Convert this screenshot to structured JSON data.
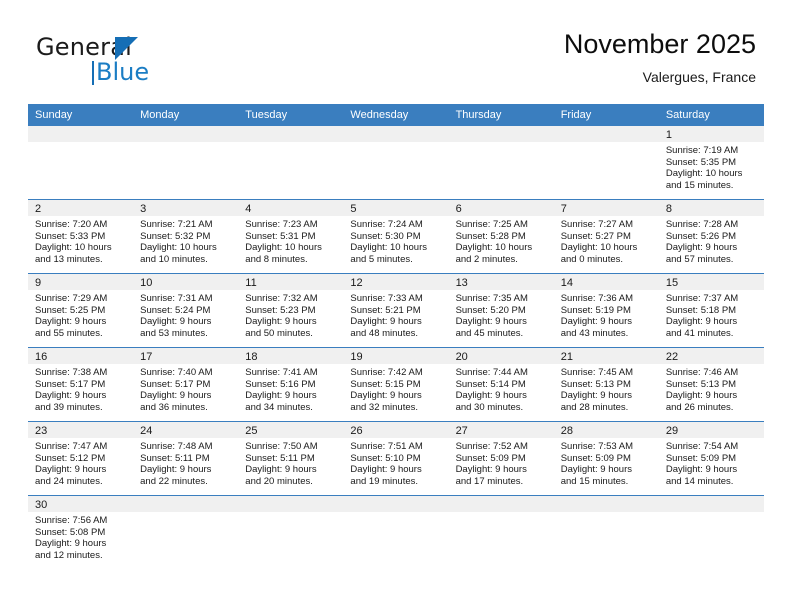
{
  "brand": {
    "name_part1": "General",
    "name_part2": "Blue",
    "logo_icon": "triangle-flag-icon",
    "accent_color": "#156eb5"
  },
  "header": {
    "month_title": "November 2025",
    "location": "Valergues, France"
  },
  "theme": {
    "header_row_bg": "#3a7ebf",
    "day_band_bg": "#f0f0f0",
    "grid_line": "#3a7ebf"
  },
  "calendar": {
    "weekday_headers": [
      "Sunday",
      "Monday",
      "Tuesday",
      "Wednesday",
      "Thursday",
      "Friday",
      "Saturday"
    ],
    "weeks": [
      [
        {
          "day": "",
          "lines": []
        },
        {
          "day": "",
          "lines": []
        },
        {
          "day": "",
          "lines": []
        },
        {
          "day": "",
          "lines": []
        },
        {
          "day": "",
          "lines": []
        },
        {
          "day": "",
          "lines": []
        },
        {
          "day": "1",
          "lines": [
            "Sunrise: 7:19 AM",
            "Sunset: 5:35 PM",
            "Daylight: 10 hours",
            "and 15 minutes."
          ]
        }
      ],
      [
        {
          "day": "2",
          "lines": [
            "Sunrise: 7:20 AM",
            "Sunset: 5:33 PM",
            "Daylight: 10 hours",
            "and 13 minutes."
          ]
        },
        {
          "day": "3",
          "lines": [
            "Sunrise: 7:21 AM",
            "Sunset: 5:32 PM",
            "Daylight: 10 hours",
            "and 10 minutes."
          ]
        },
        {
          "day": "4",
          "lines": [
            "Sunrise: 7:23 AM",
            "Sunset: 5:31 PM",
            "Daylight: 10 hours",
            "and 8 minutes."
          ]
        },
        {
          "day": "5",
          "lines": [
            "Sunrise: 7:24 AM",
            "Sunset: 5:30 PM",
            "Daylight: 10 hours",
            "and 5 minutes."
          ]
        },
        {
          "day": "6",
          "lines": [
            "Sunrise: 7:25 AM",
            "Sunset: 5:28 PM",
            "Daylight: 10 hours",
            "and 2 minutes."
          ]
        },
        {
          "day": "7",
          "lines": [
            "Sunrise: 7:27 AM",
            "Sunset: 5:27 PM",
            "Daylight: 10 hours",
            "and 0 minutes."
          ]
        },
        {
          "day": "8",
          "lines": [
            "Sunrise: 7:28 AM",
            "Sunset: 5:26 PM",
            "Daylight: 9 hours",
            "and 57 minutes."
          ]
        }
      ],
      [
        {
          "day": "9",
          "lines": [
            "Sunrise: 7:29 AM",
            "Sunset: 5:25 PM",
            "Daylight: 9 hours",
            "and 55 minutes."
          ]
        },
        {
          "day": "10",
          "lines": [
            "Sunrise: 7:31 AM",
            "Sunset: 5:24 PM",
            "Daylight: 9 hours",
            "and 53 minutes."
          ]
        },
        {
          "day": "11",
          "lines": [
            "Sunrise: 7:32 AM",
            "Sunset: 5:23 PM",
            "Daylight: 9 hours",
            "and 50 minutes."
          ]
        },
        {
          "day": "12",
          "lines": [
            "Sunrise: 7:33 AM",
            "Sunset: 5:21 PM",
            "Daylight: 9 hours",
            "and 48 minutes."
          ]
        },
        {
          "day": "13",
          "lines": [
            "Sunrise: 7:35 AM",
            "Sunset: 5:20 PM",
            "Daylight: 9 hours",
            "and 45 minutes."
          ]
        },
        {
          "day": "14",
          "lines": [
            "Sunrise: 7:36 AM",
            "Sunset: 5:19 PM",
            "Daylight: 9 hours",
            "and 43 minutes."
          ]
        },
        {
          "day": "15",
          "lines": [
            "Sunrise: 7:37 AM",
            "Sunset: 5:18 PM",
            "Daylight: 9 hours",
            "and 41 minutes."
          ]
        }
      ],
      [
        {
          "day": "16",
          "lines": [
            "Sunrise: 7:38 AM",
            "Sunset: 5:17 PM",
            "Daylight: 9 hours",
            "and 39 minutes."
          ]
        },
        {
          "day": "17",
          "lines": [
            "Sunrise: 7:40 AM",
            "Sunset: 5:17 PM",
            "Daylight: 9 hours",
            "and 36 minutes."
          ]
        },
        {
          "day": "18",
          "lines": [
            "Sunrise: 7:41 AM",
            "Sunset: 5:16 PM",
            "Daylight: 9 hours",
            "and 34 minutes."
          ]
        },
        {
          "day": "19",
          "lines": [
            "Sunrise: 7:42 AM",
            "Sunset: 5:15 PM",
            "Daylight: 9 hours",
            "and 32 minutes."
          ]
        },
        {
          "day": "20",
          "lines": [
            "Sunrise: 7:44 AM",
            "Sunset: 5:14 PM",
            "Daylight: 9 hours",
            "and 30 minutes."
          ]
        },
        {
          "day": "21",
          "lines": [
            "Sunrise: 7:45 AM",
            "Sunset: 5:13 PM",
            "Daylight: 9 hours",
            "and 28 minutes."
          ]
        },
        {
          "day": "22",
          "lines": [
            "Sunrise: 7:46 AM",
            "Sunset: 5:13 PM",
            "Daylight: 9 hours",
            "and 26 minutes."
          ]
        }
      ],
      [
        {
          "day": "23",
          "lines": [
            "Sunrise: 7:47 AM",
            "Sunset: 5:12 PM",
            "Daylight: 9 hours",
            "and 24 minutes."
          ]
        },
        {
          "day": "24",
          "lines": [
            "Sunrise: 7:48 AM",
            "Sunset: 5:11 PM",
            "Daylight: 9 hours",
            "and 22 minutes."
          ]
        },
        {
          "day": "25",
          "lines": [
            "Sunrise: 7:50 AM",
            "Sunset: 5:11 PM",
            "Daylight: 9 hours",
            "and 20 minutes."
          ]
        },
        {
          "day": "26",
          "lines": [
            "Sunrise: 7:51 AM",
            "Sunset: 5:10 PM",
            "Daylight: 9 hours",
            "and 19 minutes."
          ]
        },
        {
          "day": "27",
          "lines": [
            "Sunrise: 7:52 AM",
            "Sunset: 5:09 PM",
            "Daylight: 9 hours",
            "and 17 minutes."
          ]
        },
        {
          "day": "28",
          "lines": [
            "Sunrise: 7:53 AM",
            "Sunset: 5:09 PM",
            "Daylight: 9 hours",
            "and 15 minutes."
          ]
        },
        {
          "day": "29",
          "lines": [
            "Sunrise: 7:54 AM",
            "Sunset: 5:09 PM",
            "Daylight: 9 hours",
            "and 14 minutes."
          ]
        }
      ],
      [
        {
          "day": "30",
          "lines": [
            "Sunrise: 7:56 AM",
            "Sunset: 5:08 PM",
            "Daylight: 9 hours",
            "and 12 minutes."
          ]
        },
        {
          "day": "",
          "lines": []
        },
        {
          "day": "",
          "lines": []
        },
        {
          "day": "",
          "lines": []
        },
        {
          "day": "",
          "lines": []
        },
        {
          "day": "",
          "lines": []
        },
        {
          "day": "",
          "lines": []
        }
      ]
    ]
  }
}
